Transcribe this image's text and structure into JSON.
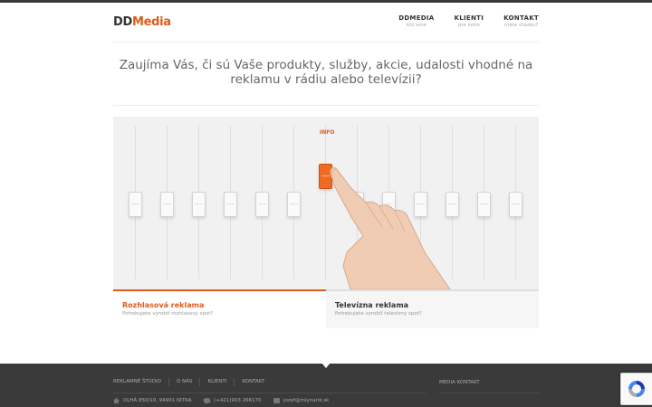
{
  "brand": {
    "part1": "DD",
    "part2": "Media"
  },
  "nav": [
    {
      "title": "DDMEDIA",
      "subtitle": "kto sme"
    },
    {
      "title": "KLIENTI",
      "subtitle": "pre koho"
    },
    {
      "title": "KONTAKT",
      "subtitle": "máte otázku?"
    }
  ],
  "headline": "Zaujíma Vás, či sú Vaše produkty, služby, akcie, udalosti vhodné na reklamu v rádiu alebo televízii?",
  "slider": {
    "label": "INFO"
  },
  "tabs": [
    {
      "title": "Rozhlasová reklama",
      "subtitle": "Potrebujete vyrobiť rozhlasový spot?"
    },
    {
      "title": "Televízna reklama",
      "subtitle": "Potrebujete vyrobiť televízny spot?"
    }
  ],
  "footer": {
    "nav": [
      "REKLAMNÉ ŠTÚDIO",
      "O NÁS",
      "KLIENTI",
      "KONTAKT"
    ],
    "address": "DLHÁ 850/10, 94901 NITRA",
    "phone": "(+421)903 266170",
    "email": "jozef@mlynarik.sk",
    "media_heading": "MEDIA KONTAKT"
  },
  "colors": {
    "accent": "#e05a1c",
    "footer_bg": "#3a3a3a"
  }
}
